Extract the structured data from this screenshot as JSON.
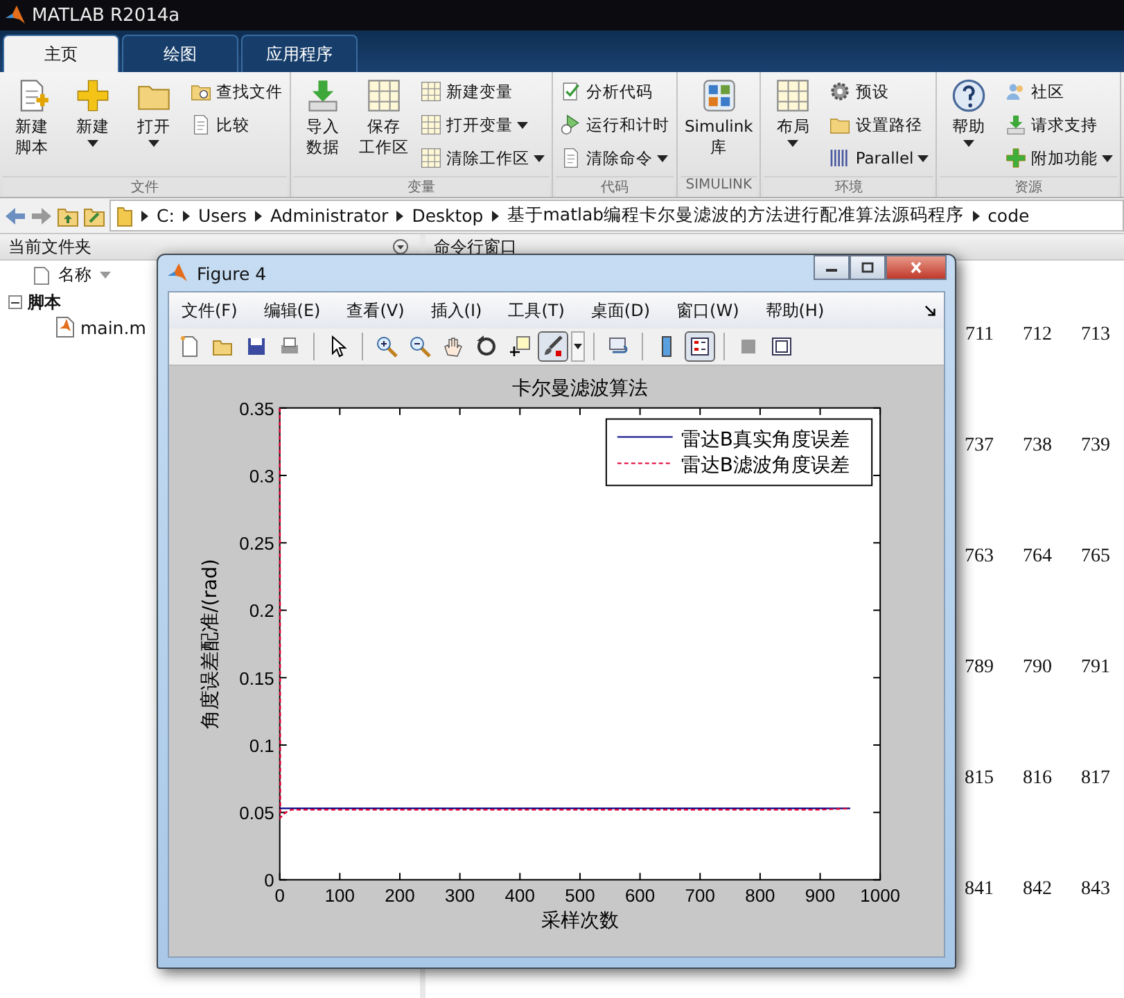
{
  "window": {
    "title": "MATLAB R2014a"
  },
  "tabs": [
    {
      "label": "主页",
      "selected": true
    },
    {
      "label": "绘图",
      "selected": false
    },
    {
      "label": "应用程序",
      "selected": false
    }
  ],
  "ribbon": {
    "groups": [
      {
        "label": "文件",
        "columns": [
          [
            {
              "kind": "large",
              "lines": [
                "新建",
                "脚本"
              ],
              "dropdown": false
            }
          ],
          [
            {
              "kind": "large",
              "lines": [
                "新建"
              ],
              "dropdown": true
            }
          ],
          [
            {
              "kind": "large",
              "lines": [
                "打开"
              ],
              "dropdown": true
            }
          ],
          [
            {
              "kind": "small",
              "lines": [
                "查找文件"
              ],
              "dropdown": false
            },
            {
              "kind": "small",
              "lines": [
                "比较"
              ],
              "dropdown": false
            }
          ]
        ]
      },
      {
        "label": "变量",
        "columns": [
          [
            {
              "kind": "large",
              "lines": [
                "导入",
                "数据"
              ],
              "dropdown": false
            }
          ],
          [
            {
              "kind": "large",
              "lines": [
                "保存",
                "工作区"
              ],
              "dropdown": false
            }
          ],
          [
            {
              "kind": "small",
              "lines": [
                "新建变量"
              ],
              "dropdown": false
            },
            {
              "kind": "small",
              "lines": [
                "打开变量"
              ],
              "dropdown": true
            },
            {
              "kind": "small",
              "lines": [
                "清除工作区"
              ],
              "dropdown": true
            }
          ]
        ]
      },
      {
        "label": "代码",
        "columns": [
          [
            {
              "kind": "small",
              "lines": [
                "分析代码"
              ],
              "dropdown": false
            },
            {
              "kind": "small",
              "lines": [
                "运行和计时"
              ],
              "dropdown": false
            },
            {
              "kind": "small",
              "lines": [
                "清除命令"
              ],
              "dropdown": true
            }
          ]
        ]
      },
      {
        "label": "SIMULINK",
        "columns": [
          [
            {
              "kind": "large",
              "lines": [
                "Simulink",
                "库"
              ],
              "dropdown": false
            }
          ]
        ]
      },
      {
        "label": "环境",
        "columns": [
          [
            {
              "kind": "large",
              "lines": [
                "布局"
              ],
              "dropdown": true
            }
          ],
          [
            {
              "kind": "small",
              "lines": [
                "预设"
              ],
              "dropdown": false
            },
            {
              "kind": "small",
              "lines": [
                "设置路径"
              ],
              "dropdown": false
            },
            {
              "kind": "small",
              "lines": [
                "Parallel"
              ],
              "dropdown": true
            }
          ]
        ]
      },
      {
        "label": "资源",
        "columns": [
          [
            {
              "kind": "large",
              "lines": [
                "帮助"
              ],
              "dropdown": true
            }
          ],
          [
            {
              "kind": "small",
              "lines": [
                "社区"
              ],
              "dropdown": false
            },
            {
              "kind": "small",
              "lines": [
                "请求支持"
              ],
              "dropdown": false
            },
            {
              "kind": "small",
              "lines": [
                "附加功能"
              ],
              "dropdown": true
            }
          ]
        ]
      }
    ]
  },
  "address": [
    "C:",
    "Users",
    "Administrator",
    "Desktop",
    "基于matlab编程卡尔曼滤波的方法进行配准算法源码程序",
    "code"
  ],
  "file_panel": {
    "title": "当前文件夹",
    "column": "名称",
    "tree": [
      {
        "label": "脚本",
        "expanded": true,
        "children": [
          {
            "label": "main.m"
          }
        ]
      }
    ]
  },
  "command_window": {
    "title": "命令行窗口",
    "rows": [
      [
        "711",
        "712",
        "713"
      ],
      [
        "737",
        "738",
        "739"
      ],
      [
        "763",
        "764",
        "765"
      ],
      [
        "789",
        "790",
        "791"
      ],
      [
        "815",
        "816",
        "817"
      ],
      [
        "841",
        "842",
        "843"
      ]
    ]
  },
  "figure": {
    "title": "Figure 4",
    "menu": [
      "文件(F)",
      "编辑(E)",
      "查看(V)",
      "插入(I)",
      "工具(T)",
      "桌面(D)",
      "窗口(W)",
      "帮助(H)"
    ],
    "toolbar": [
      [
        {
          "pressed": false
        },
        {
          "pressed": false
        },
        {
          "pressed": false
        },
        {
          "pressed": false
        }
      ],
      [
        {
          "pressed": false
        }
      ],
      [
        {
          "pressed": false
        },
        {
          "pressed": false
        },
        {
          "pressed": false
        },
        {
          "pressed": false
        },
        {
          "pressed": false
        },
        {
          "pressed": true
        }
      ],
      [
        {
          "pressed": false
        }
      ],
      [
        {
          "pressed": false
        },
        {
          "pressed": true
        }
      ],
      [
        {
          "pressed": false
        },
        {
          "pressed": false
        }
      ]
    ],
    "chart_data": {
      "type": "line",
      "title": "卡尔曼滤波算法",
      "xlabel": "采样次数",
      "ylabel": "角度误差配准/(rad)",
      "x": [
        0,
        1,
        5,
        10,
        20,
        50,
        100,
        200,
        300,
        400,
        500,
        600,
        700,
        800,
        900,
        950
      ],
      "series": [
        {
          "name": "雷达B真实角度误差",
          "color": "#000080",
          "line_style": "solid",
          "values": [
            0.053,
            0.053,
            0.053,
            0.053,
            0.053,
            0.053,
            0.053,
            0.053,
            0.053,
            0.053,
            0.053,
            0.053,
            0.053,
            0.053,
            0.053,
            0.053
          ]
        },
        {
          "name": "雷达B滤波角度误差",
          "color": "#dd0033",
          "line_style": "dashed",
          "values": [
            0.35,
            0.046,
            0.048,
            0.05,
            0.052,
            0.052,
            0.052,
            0.052,
            0.052,
            0.052,
            0.052,
            0.052,
            0.052,
            0.052,
            0.052,
            0.053
          ]
        }
      ],
      "legend": true,
      "xlim": [
        0,
        1000
      ],
      "ylim": [
        0,
        0.35
      ],
      "xticks": [
        0,
        100,
        200,
        300,
        400,
        500,
        600,
        700,
        800,
        900,
        1000
      ],
      "yticks": [
        0,
        0.05,
        0.1,
        0.15,
        0.2,
        0.25,
        0.3,
        0.35
      ]
    }
  }
}
